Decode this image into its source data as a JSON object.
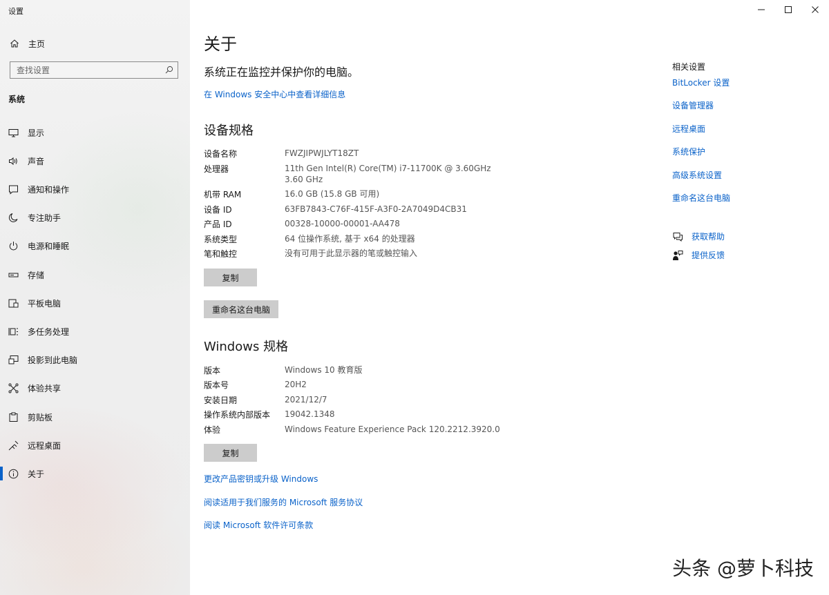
{
  "window": {
    "title": "设置",
    "controls": {
      "minimize": "minimize-icon",
      "maximize": "maximize-icon",
      "close": "close-icon"
    }
  },
  "sidebar": {
    "home_label": "主页",
    "search_placeholder": "查找设置",
    "section_label": "系统",
    "items": [
      {
        "label": "显示",
        "icon": "display-icon"
      },
      {
        "label": "声音",
        "icon": "sound-icon"
      },
      {
        "label": "通知和操作",
        "icon": "notification-icon"
      },
      {
        "label": "专注助手",
        "icon": "focus-assist-icon"
      },
      {
        "label": "电源和睡眠",
        "icon": "power-icon"
      },
      {
        "label": "存储",
        "icon": "storage-icon"
      },
      {
        "label": "平板电脑",
        "icon": "tablet-icon"
      },
      {
        "label": "多任务处理",
        "icon": "multitasking-icon"
      },
      {
        "label": "投影到此电脑",
        "icon": "projecting-icon"
      },
      {
        "label": "体验共享",
        "icon": "shared-experiences-icon"
      },
      {
        "label": "剪贴板",
        "icon": "clipboard-icon"
      },
      {
        "label": "远程桌面",
        "icon": "remote-desktop-icon"
      },
      {
        "label": "关于",
        "icon": "info-icon",
        "active": true
      }
    ]
  },
  "main": {
    "title": "关于",
    "security_status": "系统正在监控并保护你的电脑。",
    "security_link": "在 Windows 安全中心中查看详细信息",
    "device_specs": {
      "heading": "设备规格",
      "rows": [
        {
          "key": "设备名称",
          "value": "FWZJIPWJLYT18ZT"
        },
        {
          "key": "处理器",
          "value": "11th Gen Intel(R) Core(TM) i7-11700K @ 3.60GHz",
          "value2": "3.60 GHz"
        },
        {
          "key": "机带 RAM",
          "value": "16.0 GB (15.8 GB 可用)"
        },
        {
          "key": "设备 ID",
          "value": "63FB7843-C76F-415F-A3F0-2A7049D4CB31"
        },
        {
          "key": "产品 ID",
          "value": "00328-10000-00001-AA478"
        },
        {
          "key": "系统类型",
          "value": "64 位操作系统, 基于 x64 的处理器"
        },
        {
          "key": "笔和触控",
          "value": "没有可用于此显示器的笔或触控输入"
        }
      ],
      "copy_button": "复制",
      "rename_button": "重命名这台电脑"
    },
    "windows_specs": {
      "heading": "Windows 规格",
      "rows": [
        {
          "key": "版本",
          "value": "Windows 10 教育版"
        },
        {
          "key": "版本号",
          "value": "20H2"
        },
        {
          "key": "安装日期",
          "value": "2021/12/7"
        },
        {
          "key": "操作系统内部版本",
          "value": "19042.1348"
        },
        {
          "key": "体验",
          "value": "Windows Feature Experience Pack 120.2212.3920.0"
        }
      ],
      "copy_button": "复制"
    },
    "links": [
      "更改产品密钥或升级 Windows",
      "阅读适用于我们服务的 Microsoft 服务协议",
      "阅读 Microsoft 软件许可条款"
    ]
  },
  "related": {
    "title": "相关设置",
    "links": [
      "BitLocker 设置",
      "设备管理器",
      "远程桌面",
      "系统保护",
      "高级系统设置",
      "重命名这台电脑"
    ],
    "help": {
      "label": "获取帮助",
      "icon": "help-chat-icon"
    },
    "feedback": {
      "label": "提供反馈",
      "icon": "feedback-icon"
    }
  },
  "watermark": "头条 @萝卜科技",
  "colors": {
    "accent": "#0a62c9",
    "button_bg": "#cccccc"
  }
}
